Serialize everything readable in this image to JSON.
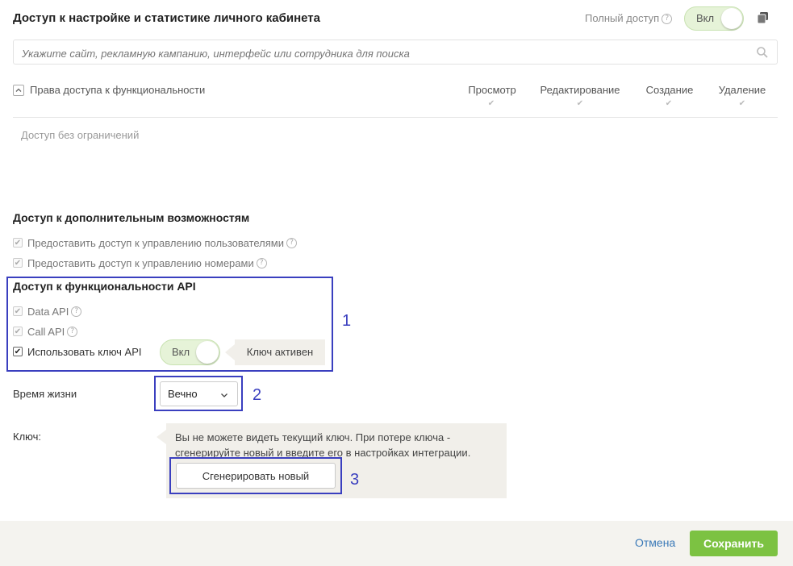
{
  "section_access": {
    "title": "Доступ к настройке и статистике личного кабинета",
    "full_access_label": "Полный доступ",
    "full_access_toggle": "Вкл",
    "search_placeholder": "Укажите сайт, рекламную кампанию, интерфейс или сотрудника для поиска",
    "rights_header": "Права доступа к функциональности",
    "columns": [
      "Просмотр",
      "Редактирование",
      "Создание",
      "Удаление"
    ],
    "no_limits_text": "Доступ без ограничений"
  },
  "section_extra": {
    "title": "Доступ к дополнительным возможностям",
    "items": [
      "Предоставить доступ к управлению пользователями",
      "Предоставить доступ к управлению номерами"
    ]
  },
  "section_api": {
    "title": "Доступ к функциональности API",
    "items": [
      "Data API",
      "Call API"
    ],
    "use_key_label": "Использовать ключ API",
    "use_key_toggle": "Вкл",
    "key_status": "Ключ активен"
  },
  "lifetime": {
    "label": "Время жизни",
    "value": "Вечно"
  },
  "key": {
    "label": "Ключ:",
    "info_line1": "Вы не можете видеть текущий ключ. При потере ключа -",
    "info_line2": "сгенерируйте новый и введите его в настройках интеграции.",
    "generate_button": "Сгенерировать новый"
  },
  "markers": [
    "1",
    "2",
    "3"
  ],
  "footer": {
    "cancel": "Отмена",
    "save": "Сохранить"
  },
  "colors": {
    "accent_green": "#7cc242",
    "frame_blue": "#3a3fbf",
    "link_blue": "#3b7ab8"
  }
}
